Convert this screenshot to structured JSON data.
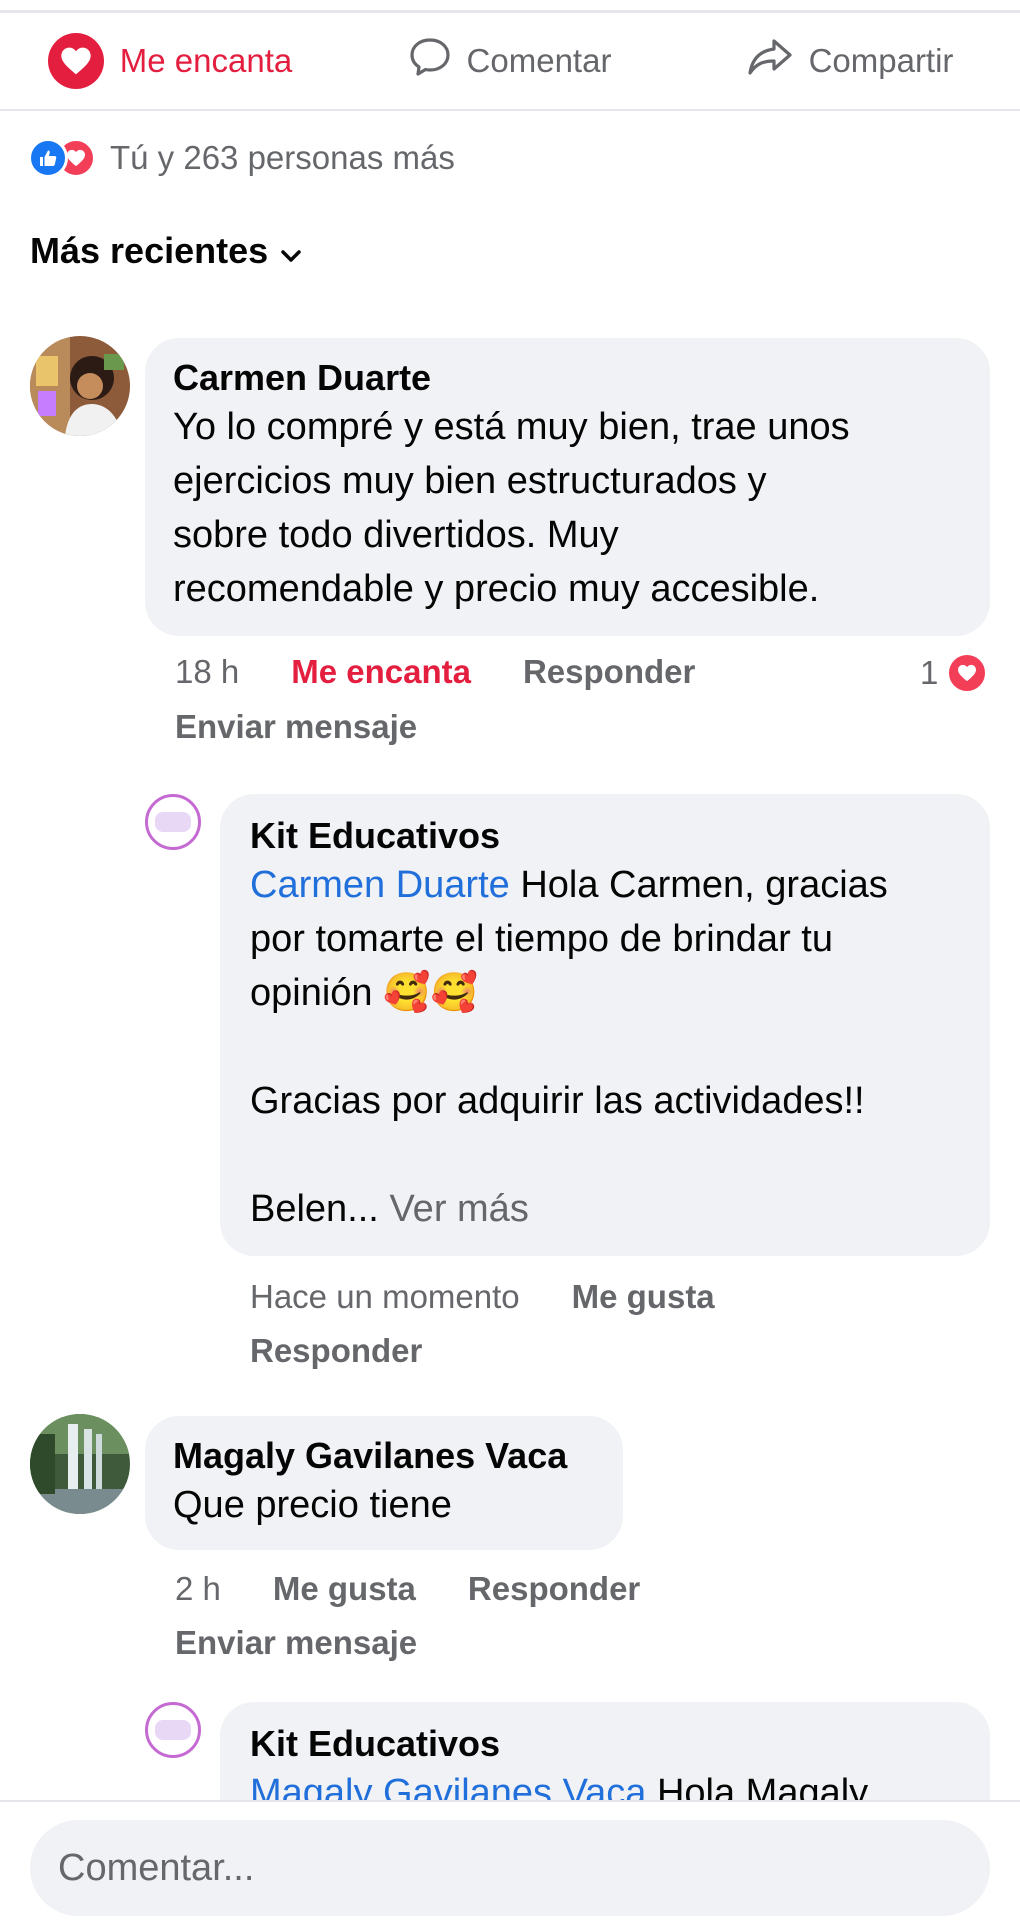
{
  "actions": {
    "love": "Me encanta",
    "comment": "Comentar",
    "share": "Compartir"
  },
  "reactions_summary": "Tú y 263 personas más",
  "sort_label": "Más recientes",
  "comments": [
    {
      "author": "Carmen Duarte",
      "lines": [
        "Yo lo compré y está muy bien, trae unos",
        "ejercicios muy bien estructurados y",
        "sobre todo divertidos. Muy",
        "recomendable y precio muy accesible."
      ],
      "time": "18 h",
      "like": "Me encanta",
      "reply": "Responder",
      "send": "Enviar mensaje",
      "reaction_count": "1"
    },
    {
      "author": "Kit Educativos",
      "mention": "Carmen Duarte",
      "line1_rest": " Hola Carmen, gracias",
      "line2": "por tomarte el tiempo de brindar tu",
      "line3": "opinión",
      "line3_emoji": "🥰🥰",
      "line4": "Gracias por adquirir las actividades!!",
      "line5": "Belen...",
      "see_more": "Ver más",
      "time": "Hace un momento",
      "like": "Me gusta",
      "reply": "Responder"
    },
    {
      "author": "Magaly Gavilanes Vaca",
      "text": "Que precio tiene",
      "time": "2 h",
      "like": "Me gusta",
      "reply": "Responder",
      "send": "Enviar mensaje"
    },
    {
      "author": "Kit Educativos",
      "mention": "Magaly Gavilanes Vaca",
      "line1_rest": " Hola Magaly"
    }
  ],
  "input": {
    "placeholder": "Comentar..."
  }
}
